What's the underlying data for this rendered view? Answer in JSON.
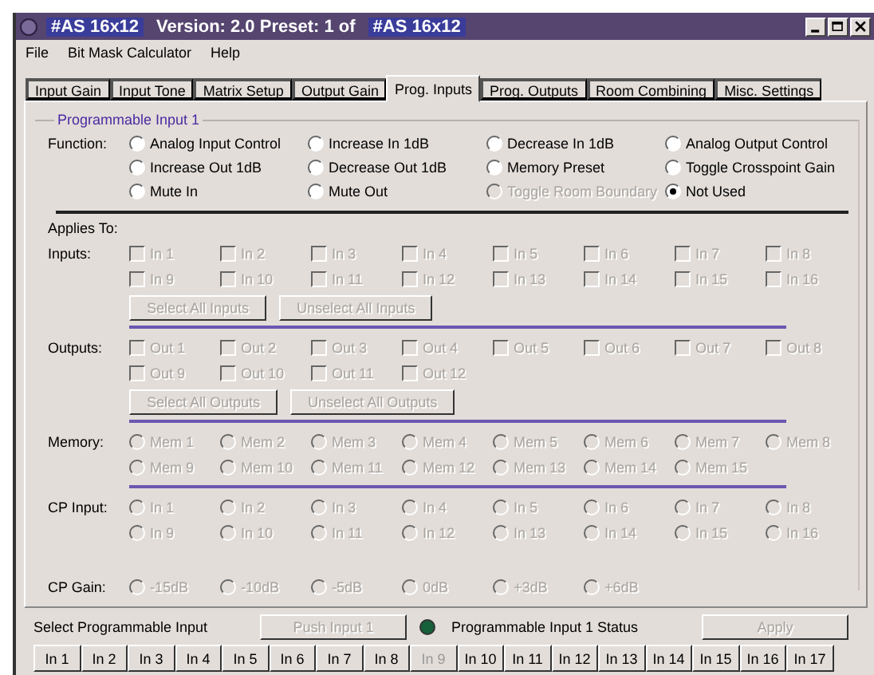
{
  "window": {
    "title_parts": [
      {
        "text": "#AS 16x12",
        "highlighted": true
      },
      {
        "text": "Version: 2.0  Preset: 1 of",
        "highlighted": false
      },
      {
        "text": "#AS 16x12",
        "highlighted": true
      }
    ]
  },
  "menu": [
    {
      "label": "File"
    },
    {
      "label": "Bit Mask Calculator"
    },
    {
      "label": "Help"
    }
  ],
  "tabs": [
    {
      "label": "Input Gain",
      "selected": false
    },
    {
      "label": "Input Tone",
      "selected": false
    },
    {
      "label": "Matrix Setup",
      "selected": false
    },
    {
      "label": "Output Gain",
      "selected": false
    },
    {
      "label": "Prog. Inputs",
      "selected": true
    },
    {
      "label": "Prog. Outputs",
      "selected": false
    },
    {
      "label": "Room Combining",
      "selected": false
    },
    {
      "label": "Misc. Settings",
      "selected": false
    }
  ],
  "group": {
    "legend": "Programmable Input 1"
  },
  "function": {
    "label": "Function:",
    "options": [
      {
        "label": "Analog Input Control",
        "selected": false,
        "disabled": false
      },
      {
        "label": "Increase In 1dB",
        "selected": false,
        "disabled": false
      },
      {
        "label": "Decrease In 1dB",
        "selected": false,
        "disabled": false
      },
      {
        "label": "Analog Output Control",
        "selected": false,
        "disabled": false
      },
      {
        "label": "Increase Out 1dB",
        "selected": false,
        "disabled": false
      },
      {
        "label": "Decrease Out 1dB",
        "selected": false,
        "disabled": false
      },
      {
        "label": "Memory Preset",
        "selected": false,
        "disabled": false
      },
      {
        "label": "Toggle Crosspoint Gain",
        "selected": false,
        "disabled": false
      },
      {
        "label": "Mute In",
        "selected": false,
        "disabled": false
      },
      {
        "label": "Mute Out",
        "selected": false,
        "disabled": false
      },
      {
        "label": "Toggle Room Boundary",
        "selected": false,
        "disabled": true
      },
      {
        "label": "Not Used",
        "selected": true,
        "disabled": false
      }
    ]
  },
  "applies_to": {
    "label": "Applies To:"
  },
  "sections": [
    {
      "kind": "checkbox",
      "label": "Inputs:",
      "items": [
        {
          "label": "In 1",
          "checked": false,
          "disabled": true
        },
        {
          "label": "In 2",
          "checked": false,
          "disabled": true
        },
        {
          "label": "In 3",
          "checked": false,
          "disabled": true
        },
        {
          "label": "In 4",
          "checked": false,
          "disabled": true
        },
        {
          "label": "In 5",
          "checked": false,
          "disabled": true
        },
        {
          "label": "In 6",
          "checked": false,
          "disabled": true
        },
        {
          "label": "In 7",
          "checked": false,
          "disabled": true
        },
        {
          "label": "In 8",
          "checked": false,
          "disabled": true
        },
        {
          "label": "In 9",
          "checked": false,
          "disabled": true
        },
        {
          "label": "In 10",
          "checked": false,
          "disabled": true
        },
        {
          "label": "In 11",
          "checked": false,
          "disabled": true
        },
        {
          "label": "In 12",
          "checked": false,
          "disabled": true
        },
        {
          "label": "In 13",
          "checked": false,
          "disabled": true
        },
        {
          "label": "In 14",
          "checked": false,
          "disabled": true
        },
        {
          "label": "In 15",
          "checked": false,
          "disabled": true
        },
        {
          "label": "In 16",
          "checked": false,
          "disabled": true
        }
      ],
      "buttons": [
        {
          "label": "Select All Inputs",
          "disabled": true
        },
        {
          "label": "Unselect All Inputs",
          "disabled": true
        }
      ],
      "rule": true
    },
    {
      "kind": "checkbox",
      "label": "Outputs:",
      "items": [
        {
          "label": "Out 1",
          "checked": false,
          "disabled": true
        },
        {
          "label": "Out 2",
          "checked": false,
          "disabled": true
        },
        {
          "label": "Out 3",
          "checked": false,
          "disabled": true
        },
        {
          "label": "Out 4",
          "checked": false,
          "disabled": true
        },
        {
          "label": "Out 5",
          "checked": false,
          "disabled": true
        },
        {
          "label": "Out 6",
          "checked": false,
          "disabled": true
        },
        {
          "label": "Out 7",
          "checked": false,
          "disabled": true
        },
        {
          "label": "Out 8",
          "checked": false,
          "disabled": true
        },
        {
          "label": "Out 9",
          "checked": false,
          "disabled": true
        },
        {
          "label": "Out 10",
          "checked": false,
          "disabled": true
        },
        {
          "label": "Out 11",
          "checked": false,
          "disabled": true
        },
        {
          "label": "Out 12",
          "checked": false,
          "disabled": true
        }
      ],
      "buttons": [
        {
          "label": "Select All Outputs",
          "disabled": true
        },
        {
          "label": "Unselect All Outputs",
          "disabled": true
        }
      ],
      "rule": true
    },
    {
      "kind": "radio",
      "label": "Memory:",
      "items": [
        {
          "label": "Mem 1",
          "selected": false,
          "disabled": true
        },
        {
          "label": "Mem 2",
          "selected": false,
          "disabled": true
        },
        {
          "label": "Mem 3",
          "selected": false,
          "disabled": true
        },
        {
          "label": "Mem 4",
          "selected": false,
          "disabled": true
        },
        {
          "label": "Mem 5",
          "selected": false,
          "disabled": true
        },
        {
          "label": "Mem 6",
          "selected": false,
          "disabled": true
        },
        {
          "label": "Mem 7",
          "selected": false,
          "disabled": true
        },
        {
          "label": "Mem 8",
          "selected": false,
          "disabled": true
        },
        {
          "label": "Mem 9",
          "selected": false,
          "disabled": true
        },
        {
          "label": "Mem 10",
          "selected": false,
          "disabled": true
        },
        {
          "label": "Mem 11",
          "selected": false,
          "disabled": true
        },
        {
          "label": "Mem 12",
          "selected": false,
          "disabled": true
        },
        {
          "label": "Mem 13",
          "selected": false,
          "disabled": true
        },
        {
          "label": "Mem 14",
          "selected": false,
          "disabled": true
        },
        {
          "label": "Mem 15",
          "selected": false,
          "disabled": true
        }
      ],
      "rule": true
    },
    {
      "kind": "radio",
      "label": "CP Input:",
      "items": [
        {
          "label": "In 1",
          "selected": false,
          "disabled": true
        },
        {
          "label": "In 2",
          "selected": false,
          "disabled": true
        },
        {
          "label": "In 3",
          "selected": false,
          "disabled": true
        },
        {
          "label": "In 4",
          "selected": false,
          "disabled": true
        },
        {
          "label": "In 5",
          "selected": false,
          "disabled": true
        },
        {
          "label": "In 6",
          "selected": false,
          "disabled": true
        },
        {
          "label": "In 7",
          "selected": false,
          "disabled": true
        },
        {
          "label": "In 8",
          "selected": false,
          "disabled": true
        },
        {
          "label": "In 9",
          "selected": false,
          "disabled": true
        },
        {
          "label": "In 10",
          "selected": false,
          "disabled": true
        },
        {
          "label": "In 11",
          "selected": false,
          "disabled": true
        },
        {
          "label": "In 12",
          "selected": false,
          "disabled": true
        },
        {
          "label": "In 13",
          "selected": false,
          "disabled": true
        },
        {
          "label": "In 14",
          "selected": false,
          "disabled": true
        },
        {
          "label": "In 15",
          "selected": false,
          "disabled": true
        },
        {
          "label": "In 16",
          "selected": false,
          "disabled": true
        }
      ],
      "rule": false
    },
    {
      "kind": "radio",
      "label": "CP Gain:",
      "items": [
        {
          "label": "-15dB",
          "selected": false,
          "disabled": true
        },
        {
          "label": "-10dB",
          "selected": false,
          "disabled": true
        },
        {
          "label": "-5dB",
          "selected": false,
          "disabled": true
        },
        {
          "label": "0dB",
          "selected": false,
          "disabled": true
        },
        {
          "label": "+3dB",
          "selected": false,
          "disabled": true
        },
        {
          "label": "+6dB",
          "selected": false,
          "disabled": true
        }
      ],
      "rule": false
    }
  ],
  "bottom": {
    "label": "Select Programmable Input",
    "push_button": {
      "label": "Push Input 1",
      "disabled": true
    },
    "status": {
      "label": "Programmable Input 1 Status",
      "color": "#16603a"
    },
    "apply": {
      "label": "Apply",
      "disabled": true
    }
  },
  "input_buttons": [
    {
      "label": "In 1",
      "disabled": false
    },
    {
      "label": "In 2",
      "disabled": false
    },
    {
      "label": "In 3",
      "disabled": false
    },
    {
      "label": "In 4",
      "disabled": false
    },
    {
      "label": "In 5",
      "disabled": false
    },
    {
      "label": "In 6",
      "disabled": false
    },
    {
      "label": "In 7",
      "disabled": false
    },
    {
      "label": "In 8",
      "disabled": false
    },
    {
      "label": "In 9",
      "disabled": true
    },
    {
      "label": "In 10",
      "disabled": false
    },
    {
      "label": "In 11",
      "disabled": false
    },
    {
      "label": "In 12",
      "disabled": false
    },
    {
      "label": "In 13",
      "disabled": false
    },
    {
      "label": "In 14",
      "disabled": false
    },
    {
      "label": "In 15",
      "disabled": false
    },
    {
      "label": "In 16",
      "disabled": false
    },
    {
      "label": "In 17",
      "disabled": false
    }
  ]
}
